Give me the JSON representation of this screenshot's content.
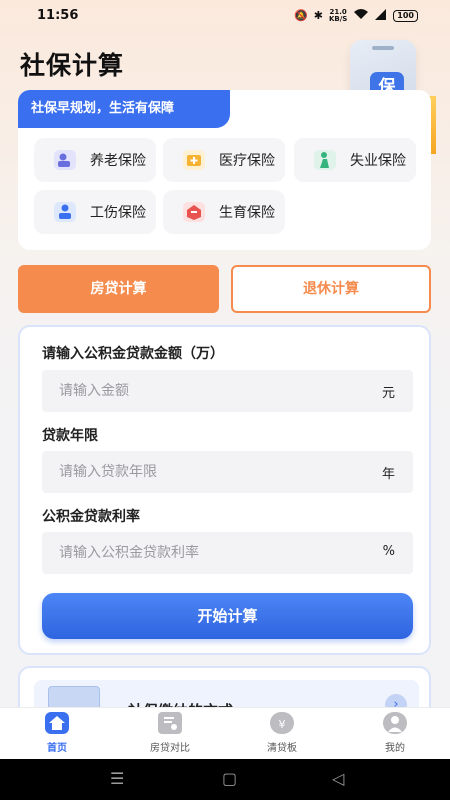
{
  "status_bar": {
    "time": "11:56",
    "net_speed_value": "21.0",
    "net_speed_unit": "KB/S",
    "battery": "100"
  },
  "header": {
    "title": "社保计算",
    "hero_badge": "保"
  },
  "insurance": {
    "banner": "社保早规划，生活有保障",
    "items": [
      {
        "label": "养老保险",
        "icon": "pension-icon",
        "color": "#6a6fe0"
      },
      {
        "label": "医疗保险",
        "icon": "medical-kit-icon",
        "color": "#f5b233"
      },
      {
        "label": "失业保险",
        "icon": "unemployment-icon",
        "color": "#35b37e"
      },
      {
        "label": "工伤保险",
        "icon": "work-injury-icon",
        "color": "#3a6ff0"
      },
      {
        "label": "生育保险",
        "icon": "maternity-icon",
        "color": "#e8524f"
      }
    ]
  },
  "tabs": [
    {
      "label": "房贷计算",
      "active": true
    },
    {
      "label": "退休计算",
      "active": false
    }
  ],
  "form": {
    "amount_label": "请输入公积金贷款金额（万）",
    "amount_placeholder": "请输入金额",
    "amount_unit": "元",
    "term_label": "贷款年限",
    "term_placeholder": "请输入贷款年限",
    "term_unit": "年",
    "rate_label": "公积金贷款利率",
    "rate_placeholder": "请输入公积金贷款利率",
    "rate_unit": "%",
    "submit_label": "开始计算"
  },
  "peek_card": {
    "title": "社保缴纳的方式"
  },
  "bottom_nav": [
    {
      "label": "首页",
      "icon": "home-icon",
      "active": true
    },
    {
      "label": "房贷对比",
      "icon": "loan-compare-icon",
      "active": false
    },
    {
      "label": "清贷板",
      "icon": "money-bag-icon",
      "active": false
    },
    {
      "label": "我的",
      "icon": "user-icon",
      "active": false
    }
  ],
  "colors": {
    "accent_blue": "#3a6ff0",
    "accent_orange": "#f58b4d"
  }
}
